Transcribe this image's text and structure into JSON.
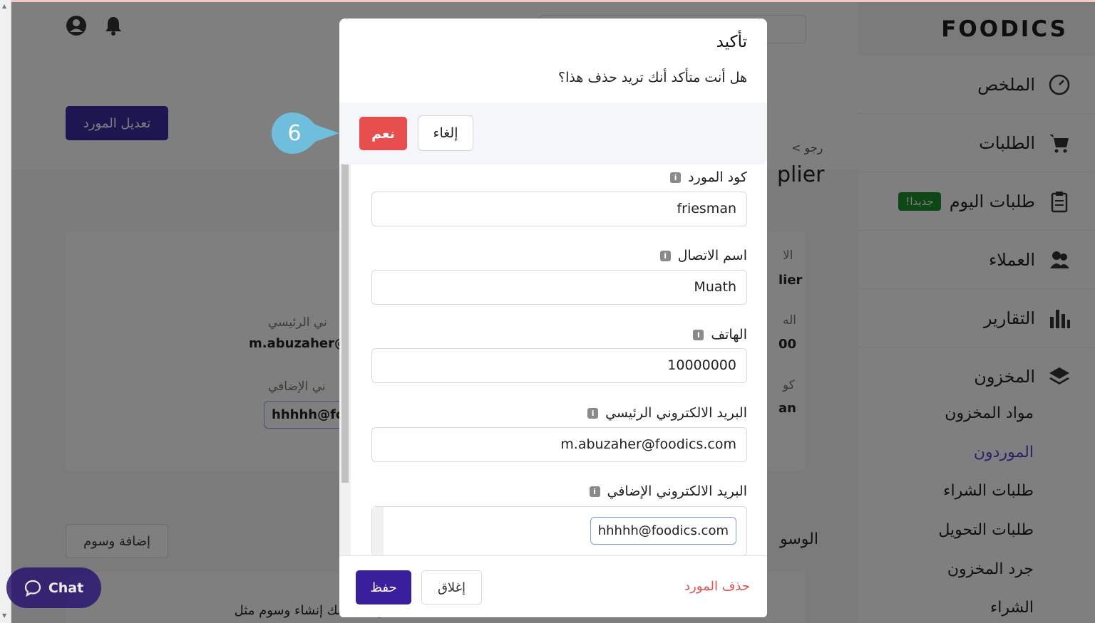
{
  "app": {
    "logo": "FOODICS",
    "page_title_fragment": "plier",
    "back_fragment": "< رجو",
    "edit_supplier_button": "تعديل المورد",
    "add_tags_button": "إضافة وسوم",
    "section_fragment": "الوسو",
    "bottom_text": "ولة. يمكنك إنشاء وسوم مثل"
  },
  "sidebar": {
    "items": [
      {
        "label": "الملخص",
        "icon": "dashboard-icon"
      },
      {
        "label": "الطلبات",
        "icon": "cart-icon"
      },
      {
        "label": "طلبات اليوم",
        "icon": "clipboard-icon",
        "badge": "جديدا!"
      },
      {
        "label": "العملاء",
        "icon": "customers-icon"
      },
      {
        "label": "التقارير",
        "icon": "reports-icon"
      },
      {
        "label": "المخزون",
        "icon": "layers-icon"
      }
    ],
    "subitems": [
      {
        "label": "مواد المخزون",
        "active": false
      },
      {
        "label": "الموردون",
        "active": true
      },
      {
        "label": "طلبات الشراء",
        "active": false
      },
      {
        "label": "طلبات التحويل",
        "active": false
      },
      {
        "label": "جرد المخزون",
        "active": false
      },
      {
        "label": "الشراء",
        "active": false
      }
    ]
  },
  "card": {
    "email_label_fragment": "ني الرئيسي",
    "email_value_fragment": "m.abuzaher@f",
    "extra_email_label_fragment": "ني الإضافي",
    "extra_email_chip_fragment": "hhhhh@fo",
    "right_label_1": "الا",
    "right_value_1": "lier",
    "right_label_2": "اله",
    "right_value_2": "00",
    "right_label_3": "كو",
    "right_value_3": "an"
  },
  "edit_modal": {
    "fields": [
      {
        "label": "كود المورد",
        "value": "friesman"
      },
      {
        "label": "اسم الاتصال",
        "value": "Muath"
      },
      {
        "label": "الهاتف",
        "value": "10000000"
      },
      {
        "label": "البريد الالكتروني الرئيسي",
        "value": "m.abuzaher@foodics.com"
      },
      {
        "label": "البريد الالكتروني الإضافي",
        "value": "hhhhh@foodics.com"
      }
    ],
    "save_label": "حفظ",
    "close_label": "إغلاق",
    "delete_label": "حذف المورد"
  },
  "confirm": {
    "title": "تأكيد",
    "message": "هل أنت متأكد أنك تريد حذف هذا؟",
    "yes_label": "نعم",
    "cancel_label": "إلغاء"
  },
  "callout": {
    "step": "6"
  },
  "chat": {
    "label": "Chat"
  },
  "colors": {
    "brand": "#3a1f9c",
    "danger": "#e94e4e",
    "active_nav": "#5d3fd3",
    "new_badge": "#1e8c2a",
    "callout": "#6fbfdc"
  }
}
